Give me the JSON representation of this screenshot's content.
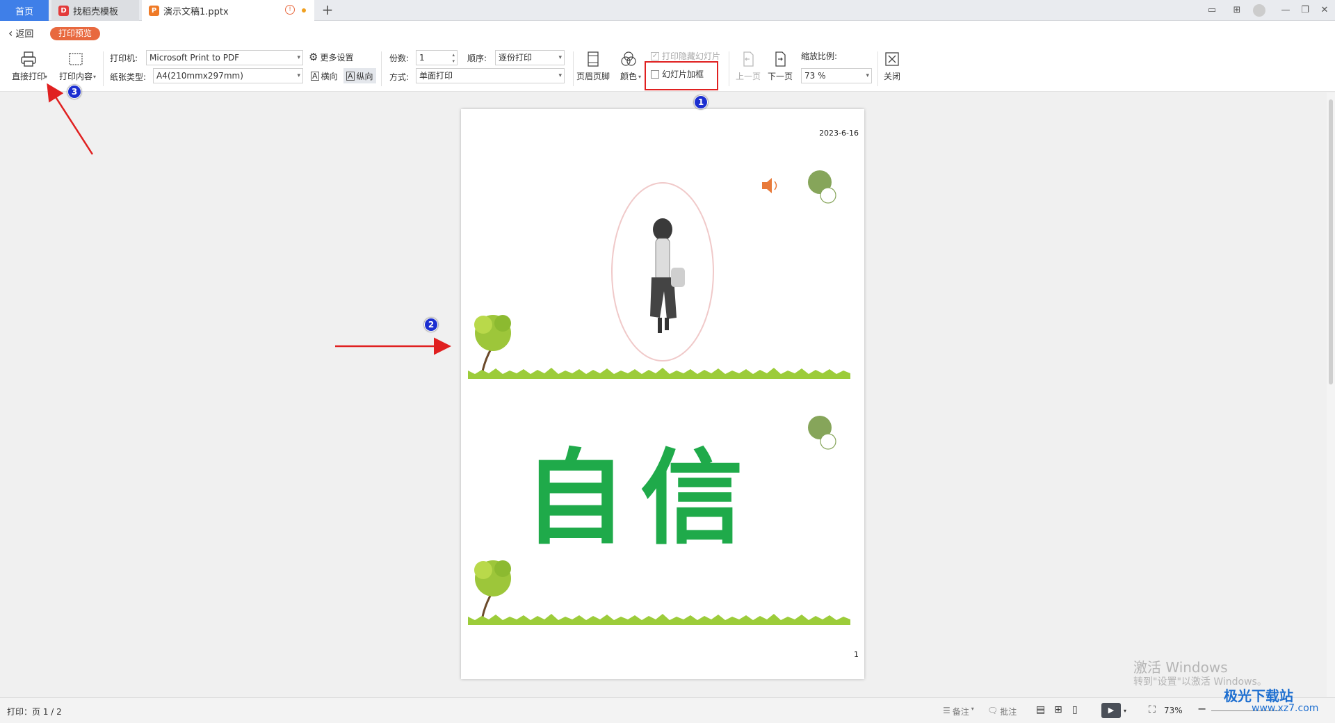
{
  "tabs": {
    "home": "首页",
    "templates": "找稻壳模板",
    "document": "演示文稿1.pptx"
  },
  "subbar": {
    "back": "返回",
    "print_preview": "打印预览"
  },
  "toolbar": {
    "direct_print": "直接打印",
    "print_content": "打印内容",
    "printer_label": "打印机:",
    "printer_value": "Microsoft Print to PDF",
    "paper_label": "纸张类型:",
    "paper_value": "A4(210mmx297mm)",
    "more_settings": "更多设置",
    "landscape": "横向",
    "portrait": "纵向",
    "copies_label": "份数:",
    "copies_value": "1",
    "order_label": "顺序:",
    "order_value": "逐份打印",
    "mode_label": "方式:",
    "mode_value": "单面打印",
    "header_footer": "页眉页脚",
    "color": "颜色",
    "print_hidden": "打印隐藏幻灯片",
    "slide_frame": "幻灯片加框",
    "prev_page": "上一页",
    "next_page": "下一页",
    "zoom_label": "缩放比例:",
    "zoom_value": "73 %",
    "close": "关闭"
  },
  "preview": {
    "date": "2023-6-16",
    "slide2_text": "自信",
    "page_number": "1"
  },
  "annotations": {
    "bubble1": "1",
    "bubble2": "2",
    "bubble3": "3"
  },
  "status": {
    "print_page": "打印：页 1 / 2",
    "notes": "备注",
    "comments": "批注",
    "zoom": "73%"
  },
  "watermark": {
    "line1": "激活 Windows",
    "line2": "转到\"设置\"以激活 Windows。",
    "site": "极光下载站",
    "site_url": "www.xz7.com"
  },
  "colors": {
    "accent": "#3f7fe8",
    "badge": "#e8693f",
    "annotation_red": "#e02020",
    "slide_green": "#1faa4a",
    "circle_green": "#86a55a"
  }
}
